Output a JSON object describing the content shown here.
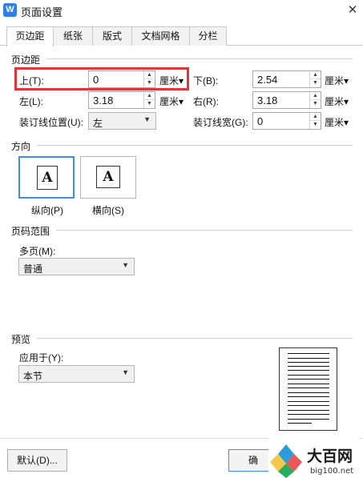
{
  "window": {
    "title": "页面设置",
    "icon_glyph": "W",
    "close_glyph": "✕"
  },
  "tabs": [
    {
      "label": "页边距"
    },
    {
      "label": "纸张"
    },
    {
      "label": "版式"
    },
    {
      "label": "文档网格"
    },
    {
      "label": "分栏"
    }
  ],
  "margins": {
    "section_title": "页边距",
    "top": {
      "label": "上(T):",
      "value": "0",
      "unit": "厘米▾"
    },
    "bottom": {
      "label": "下(B):",
      "value": "2.54",
      "unit": "厘米▾"
    },
    "left": {
      "label": "左(L):",
      "value": "3.18",
      "unit": "厘米▾"
    },
    "right": {
      "label": "右(R):",
      "value": "3.18",
      "unit": "厘米▾"
    },
    "gutter_pos": {
      "label": "装订线位置(U):",
      "value": "左"
    },
    "gutter_width": {
      "label": "装订线宽(G):",
      "value": "0",
      "unit": "厘米▾"
    }
  },
  "orientation": {
    "section_title": "方向",
    "icon_letter": "A",
    "portrait_label": "纵向(P)",
    "landscape_label": "横向(S)"
  },
  "pages": {
    "section_title": "页码范围",
    "multiple_label": "多页(M):",
    "multiple_value": "普通"
  },
  "preview": {
    "section_title": "预览",
    "apply_label": "应用于(Y):",
    "apply_value": "本节"
  },
  "buttons": {
    "default_label": "默认(D)...",
    "ok_partial": "确"
  },
  "watermark": {
    "site_name": "大百网",
    "site_url": "big100.net"
  },
  "colors": {
    "highlight_box": "#e0353b",
    "selected_orientation": "#3d8ee8"
  }
}
